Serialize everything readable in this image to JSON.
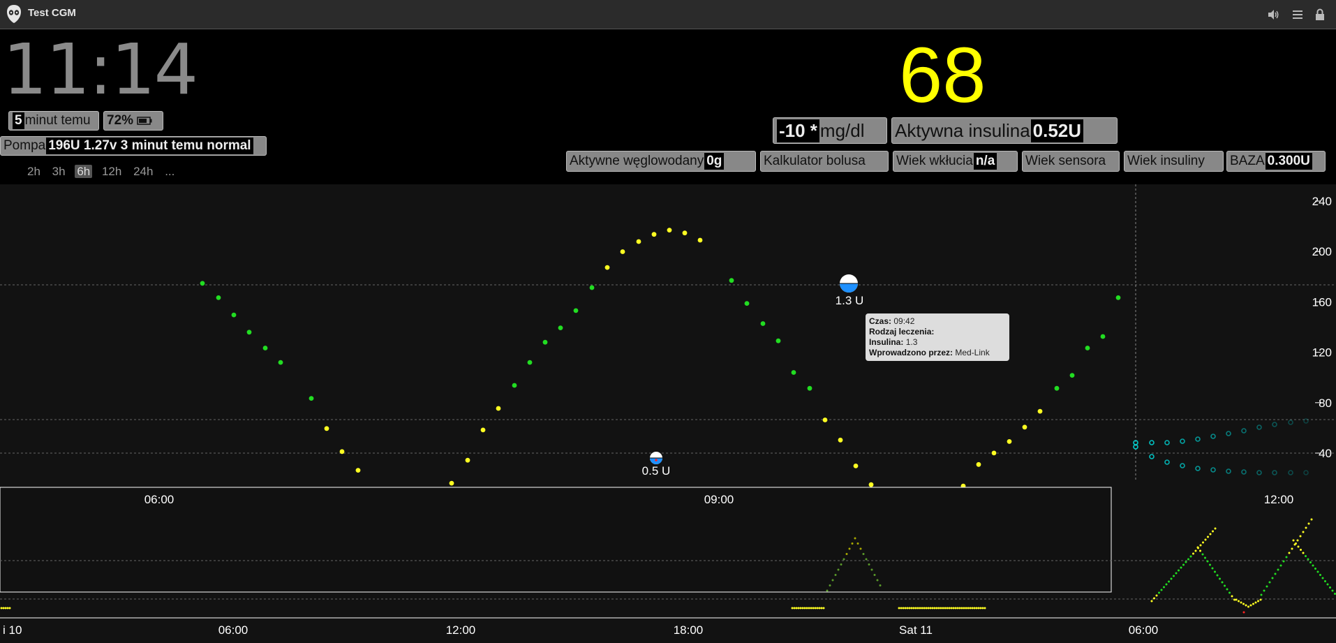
{
  "window": {
    "title": "Test CGM"
  },
  "header": {
    "clock": "11:14",
    "last_reading": {
      "value": "5",
      "label": "minut temu"
    },
    "battery": {
      "value": "72%"
    },
    "pump": {
      "label": "Pompa",
      "value": "196U 1.27v 3 minut temu normal"
    },
    "bg": {
      "value": "68",
      "color": "#ffff00"
    },
    "delta": {
      "value": "-10 *",
      "unit": "mg/dl"
    },
    "iob": {
      "label": "Aktywna insulina",
      "value": "0.52U"
    },
    "cob": {
      "label": "Aktywne węglowodany",
      "value": "0g"
    },
    "bolus_calc": {
      "label": "Kalkulator bolusa"
    },
    "cage": {
      "label": "Wiek wkłucia",
      "value": "n/a"
    },
    "sage": {
      "label": "Wiek sensora"
    },
    "iage": {
      "label": "Wiek insuliny"
    },
    "basal": {
      "label": "BAZA",
      "value": "0.300U"
    },
    "ranges": [
      "2h",
      "3h",
      "6h",
      "12h",
      "24h",
      "..."
    ],
    "selected_range": "6h"
  },
  "chart_data": {
    "type": "scatter",
    "title": "",
    "y_ticks": [
      240,
      200,
      160,
      120,
      80,
      40
    ],
    "y_range": [
      30,
      250
    ],
    "main_x_labels": [
      "06:00",
      "09:00",
      "12:00"
    ],
    "nav_x_labels": [
      "i 10",
      "06:00",
      "12:00",
      "18:00",
      "Sat 11",
      "06:00"
    ],
    "treatments": [
      {
        "label": "0.5 U",
        "time": "08:45"
      },
      {
        "label": "1.3 U",
        "time": "09:42"
      }
    ],
    "colors": {
      "in_range": "#22dd22",
      "high_low": "#ffff22",
      "forecast": "#00cccc",
      "urgent": "#ff2222"
    }
  },
  "tooltip": {
    "time_label": "Czas:",
    "time_value": "09:42",
    "type_label": "Rodzaj leczenia:",
    "type_value": "",
    "insulin_label": "Insulina:",
    "insulin_value": "1.3",
    "entered_label": "Wprowadzono przez:",
    "entered_value": "Med-Link"
  }
}
